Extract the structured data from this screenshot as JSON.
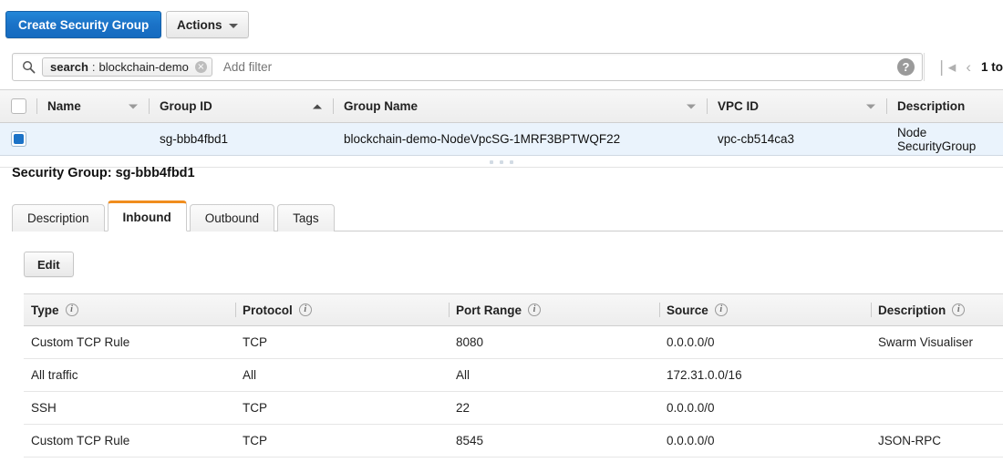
{
  "toolbar": {
    "create_label": "Create Security Group",
    "actions_label": "Actions"
  },
  "search": {
    "token_key": "search",
    "token_sep": ":",
    "token_value": "blockchain-demo",
    "remove_glyph": "×",
    "placeholder": "Add filter",
    "help_glyph": "?"
  },
  "pagination": {
    "first_glyph": "❘◂",
    "prev_glyph": "‹",
    "range_text": "1 to"
  },
  "main_table": {
    "columns": [
      {
        "label": "Name",
        "sort": "desc"
      },
      {
        "label": "Group ID",
        "sort": "asc"
      },
      {
        "label": "Group Name",
        "sort": "desc"
      },
      {
        "label": "VPC ID",
        "sort": "desc"
      },
      {
        "label": "Description",
        "sort": "none"
      }
    ],
    "row": {
      "selected": true,
      "name": "",
      "group_id": "sg-bbb4fbd1",
      "group_name": "blockchain-demo-NodeVpcSG-1MRF3BPTWQF22",
      "vpc_id": "vpc-cb514ca3",
      "description": "Node SecurityGroup"
    }
  },
  "detail": {
    "title": "Security Group: sg-bbb4fbd1",
    "tabs": [
      {
        "label": "Description",
        "active": false
      },
      {
        "label": "Inbound",
        "active": true
      },
      {
        "label": "Outbound",
        "active": false
      },
      {
        "label": "Tags",
        "active": false
      }
    ],
    "edit_label": "Edit"
  },
  "rules_table": {
    "columns": [
      "Type",
      "Protocol",
      "Port Range",
      "Source",
      "Description"
    ],
    "info_glyph": "i",
    "rows": [
      {
        "type": "Custom TCP Rule",
        "protocol": "TCP",
        "port": "8080",
        "source": "0.0.0.0/0",
        "description": "Swarm Visualiser"
      },
      {
        "type": "All traffic",
        "protocol": "All",
        "port": "All",
        "source": "172.31.0.0/16",
        "description": ""
      },
      {
        "type": "SSH",
        "protocol": "TCP",
        "port": "22",
        "source": "0.0.0.0/0",
        "description": ""
      },
      {
        "type": "Custom TCP Rule",
        "protocol": "TCP",
        "port": "8545",
        "source": "0.0.0.0/0",
        "description": "JSON-RPC"
      }
    ]
  },
  "colors": {
    "primary_blue": "#1b72c7",
    "active_tab_orange": "#f08d1e",
    "selected_row_bg": "#eaf3fc"
  }
}
